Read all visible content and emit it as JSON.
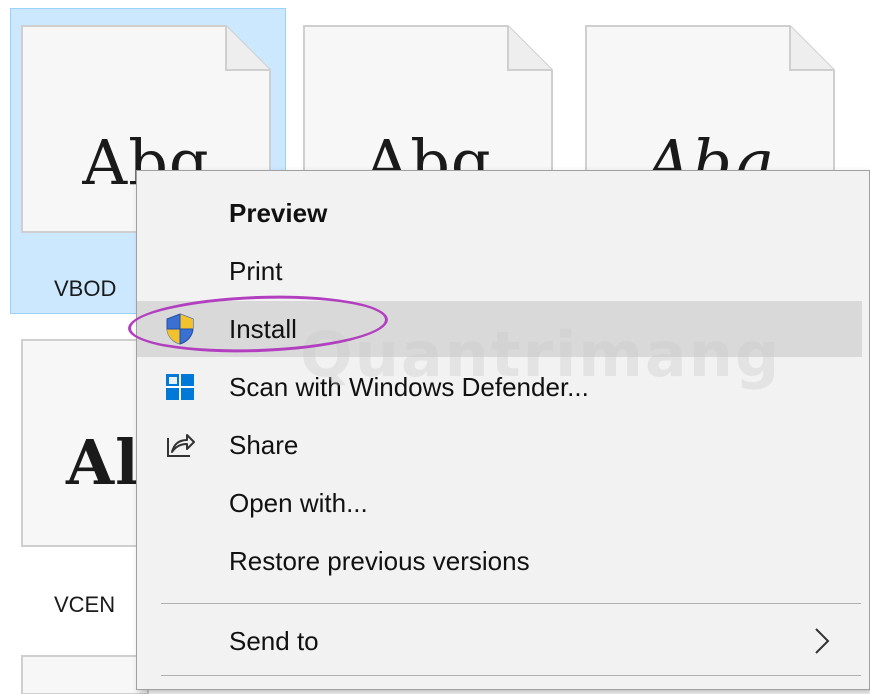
{
  "files": [
    {
      "preview_text": "Abg",
      "label": "VBOD",
      "style": "regular",
      "selected": true
    },
    {
      "preview_text": "Abg",
      "label": "",
      "style": "regular",
      "selected": false
    },
    {
      "preview_text": "Abg",
      "label": "",
      "style": "italic",
      "selected": false
    },
    {
      "preview_text": "Al",
      "label": "VCEN",
      "style": "regular",
      "selected": false
    }
  ],
  "context_menu": {
    "items": [
      {
        "label": "Preview",
        "icon": "",
        "bold": true
      },
      {
        "label": "Print",
        "icon": ""
      },
      {
        "label": "Install",
        "icon": "uac-shield-icon"
      },
      {
        "label": "Scan with Windows Defender...",
        "icon": "windows-defender-icon"
      },
      {
        "label": "Share",
        "icon": "share-icon"
      },
      {
        "label": "Open with...",
        "icon": ""
      },
      {
        "label": "Restore previous versions",
        "icon": ""
      },
      {
        "label": "Send to",
        "icon": "chevron-right-icon"
      }
    ]
  },
  "watermark": "Quantrimang",
  "colors": {
    "selection_bg": "#cce8ff",
    "menu_bg": "#f2f2f2",
    "hover_bg": "#d9d9d9",
    "annotation_ring": "#b23fbf",
    "defender_blue": "#0078d7"
  }
}
